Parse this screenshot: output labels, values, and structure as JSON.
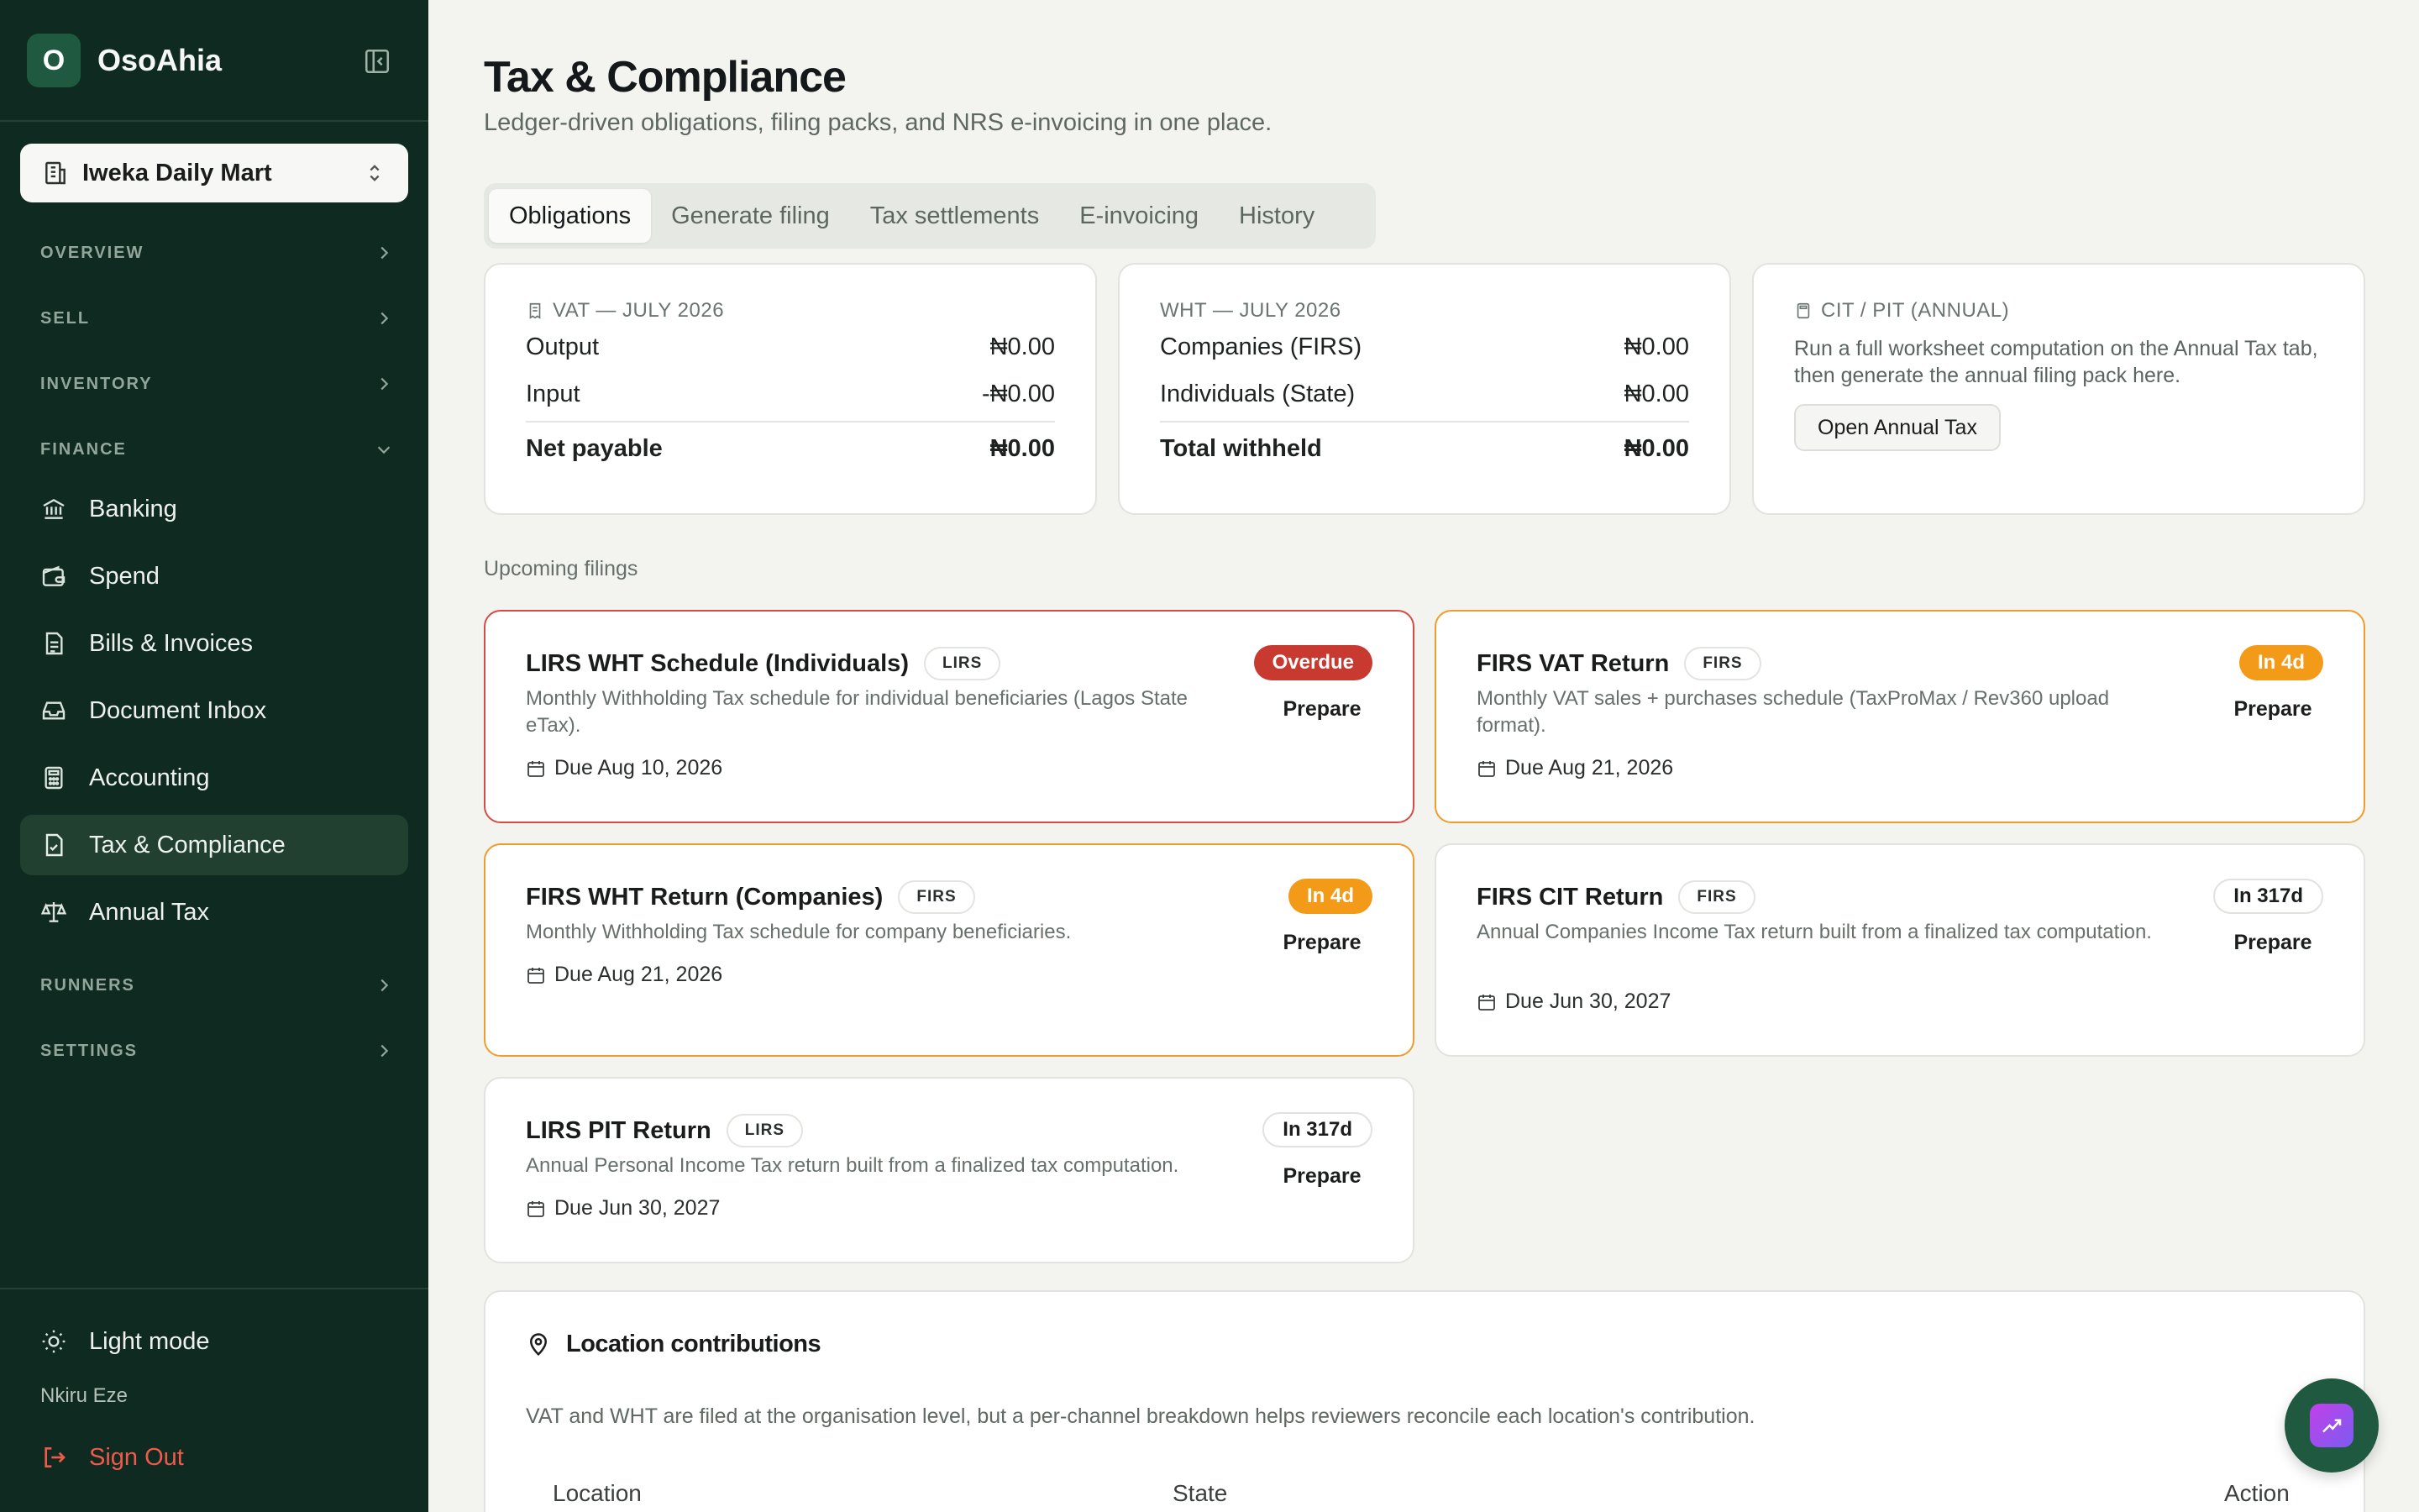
{
  "brand": {
    "logo_letter": "O",
    "name": "OsoAhia"
  },
  "org": {
    "name": "Iweka Daily Mart"
  },
  "sidebar": {
    "sections": {
      "overview": "OVERVIEW",
      "sell": "SELL",
      "inventory": "INVENTORY",
      "finance": "FINANCE",
      "runners": "RUNNERS",
      "settings": "SETTINGS"
    },
    "items": [
      {
        "label": "Banking",
        "icon": "bank-icon"
      },
      {
        "label": "Spend",
        "icon": "wallet-icon"
      },
      {
        "label": "Bills & Invoices",
        "icon": "invoice-icon"
      },
      {
        "label": "Document Inbox",
        "icon": "inbox-icon"
      },
      {
        "label": "Accounting",
        "icon": "calculator-icon"
      },
      {
        "label": "Tax & Compliance",
        "icon": "file-check-icon",
        "active": true
      },
      {
        "label": "Annual Tax",
        "icon": "scale-icon"
      }
    ],
    "light_mode": "Light mode",
    "user": "Nkiru Eze",
    "sign_out": "Sign Out"
  },
  "header": {
    "title": "Tax & Compliance",
    "subtitle": "Ledger-driven obligations, filing packs, and NRS e-invoicing in one place."
  },
  "tabs": [
    "Obligations",
    "Generate filing",
    "Tax settlements",
    "E-invoicing",
    "History"
  ],
  "summary": {
    "vat": {
      "title": "VAT — JULY 2026",
      "rows": [
        {
          "label": "Output",
          "value": "₦0.00"
        },
        {
          "label": "Input",
          "value": "-₦0.00"
        }
      ],
      "total_label": "Net payable",
      "total_value": "₦0.00"
    },
    "wht": {
      "title": "WHT — JULY 2026",
      "rows": [
        {
          "label": "Companies (FIRS)",
          "value": "₦0.00"
        },
        {
          "label": "Individuals (State)",
          "value": "₦0.00"
        }
      ],
      "total_label": "Total withheld",
      "total_value": "₦0.00"
    },
    "cit": {
      "title": "CIT / PIT (ANNUAL)",
      "text": "Run a full worksheet computation on the Annual Tax tab, then generate the annual filing pack here.",
      "button": "Open Annual Tax"
    }
  },
  "upcoming_label": "Upcoming filings",
  "filings": [
    {
      "title": "LIRS WHT Schedule (Individuals)",
      "tag": "LIRS",
      "desc": "Monthly Withholding Tax schedule for individual beneficiaries (Lagos State eTax).",
      "due": "Due Aug 10, 2026",
      "badge": "Overdue",
      "action": "Prepare"
    },
    {
      "title": "FIRS VAT Return",
      "tag": "FIRS",
      "desc": "Monthly VAT sales + purchases schedule (TaxProMax / Rev360 upload format).",
      "due": "Due Aug 21, 2026",
      "badge": "In 4d",
      "action": "Prepare"
    },
    {
      "title": "FIRS WHT Return (Companies)",
      "tag": "FIRS",
      "desc": "Monthly Withholding Tax schedule for company beneficiaries.",
      "due": "Due Aug 21, 2026",
      "badge": "In 4d",
      "action": "Prepare"
    },
    {
      "title": "FIRS CIT Return",
      "tag": "FIRS",
      "desc": "Annual Companies Income Tax return built from a finalized tax computation.",
      "due": "Due Jun 30, 2027",
      "badge": "In 317d",
      "action": "Prepare"
    },
    {
      "title": "LIRS PIT Return",
      "tag": "LIRS",
      "desc": "Annual Personal Income Tax return built from a finalized tax computation.",
      "due": "Due Jun 30, 2027",
      "badge": "In 317d",
      "action": "Prepare"
    }
  ],
  "location": {
    "title": "Location contributions",
    "desc": "VAT and WHT are filed at the organisation level, but a per-channel breakdown helps reviewers reconcile each location's contribution.",
    "columns": [
      "Location",
      "State",
      "Action"
    ]
  },
  "colors": {
    "sidebar_bg": "#0f2a20",
    "overdue": "#c83a30",
    "soon": "#f39a18",
    "sign_out": "#ef5a4a"
  }
}
